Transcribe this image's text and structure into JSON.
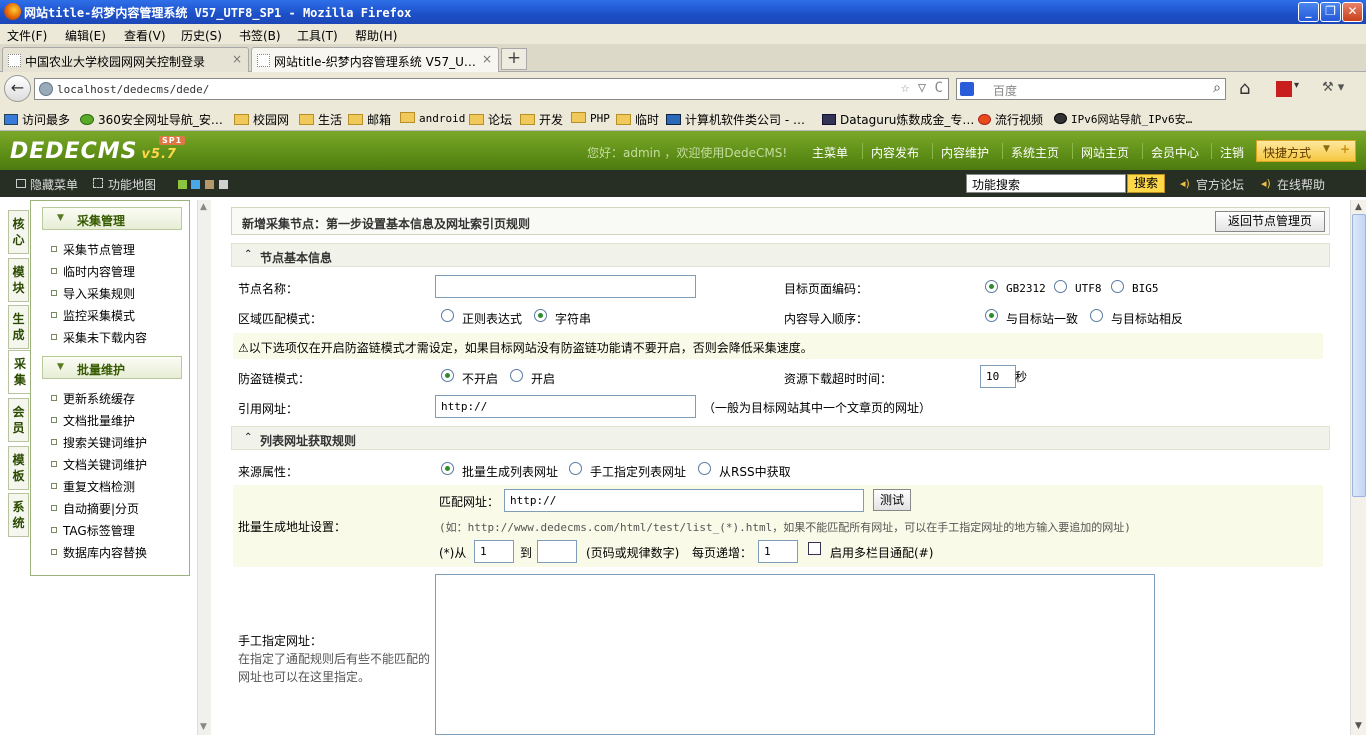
{
  "window": {
    "title": "网站title-织梦内容管理系统 V57_UTF8_SP1 - Mozilla Firefox",
    "min": "_",
    "max": "❐",
    "close": "✕"
  },
  "menubar": [
    "文件(F)",
    "编辑(E)",
    "查看(V)",
    "历史(S)",
    "书签(B)",
    "工具(T)",
    "帮助(H)"
  ],
  "tabs": [
    {
      "label": "中国农业大学校园网网关控制登录",
      "close": "×"
    },
    {
      "label": "网站title-织梦内容管理系统 V57_U…",
      "close": "×"
    }
  ],
  "newtab": "+",
  "nav": {
    "back": "←",
    "url": "localhost/dedecms/dede/",
    "url_icons": "☆ ▽ C",
    "search_placeholder": "百度",
    "search_icon": "⌕",
    "home": "⌂",
    "addon": "▾",
    "tools": "⚒ ▾"
  },
  "bookmarks": [
    "访问最多",
    "360安全网址导航_安…",
    "校园网",
    "生活",
    "邮箱",
    "android",
    "论坛",
    "开发",
    "PHP",
    "临时",
    "计算机软件类公司 - …",
    "Dataguru炼数成金_专…",
    "流行视频",
    "IPv6网站导航_IPv6安…"
  ],
  "header": {
    "logo": "DEDECMS",
    "version": "v5.7",
    "sp": "SP1",
    "welcome": "您好：admin ，欢迎使用DedeCMS!",
    "nav": [
      "主菜单",
      "内容发布",
      "内容维护",
      "系统主页",
      "网站主页",
      "会员中心",
      "注销"
    ],
    "quick": "快捷方式"
  },
  "toolbar": {
    "hide_menu": "隐藏菜单",
    "func_map": "功能地图",
    "search_value": "功能搜索",
    "search_btn": "搜索",
    "forum": "官方论坛",
    "help": "在线帮助"
  },
  "vtabs": [
    "核心",
    "模块",
    "生成",
    "采集",
    "会员",
    "模板",
    "系统"
  ],
  "leftmenu": {
    "group1": "采集管理",
    "group1_items": [
      "采集节点管理",
      "临时内容管理",
      "导入采集规则",
      "监控采集模式",
      "采集未下载内容"
    ],
    "group2": "批量维护",
    "group2_items": [
      "更新系统缓存",
      "文档批量维护",
      "搜索关键词维护",
      "文档关键词维护",
      "重复文档检测",
      "自动摘要|分页",
      "TAG标签管理",
      "数据库内容替换"
    ]
  },
  "main": {
    "title": "新增采集节点：第一步设置基本信息及网址索引页规则",
    "return_btn": "返回节点管理页",
    "sec1": "节点基本信息",
    "sec2": "列表网址获取规则",
    "node_name_lbl": "节点名称：",
    "encoding_lbl": "目标页面编码：",
    "enc_opts": [
      "GB2312",
      "UTF8",
      "BIG5"
    ],
    "match_mode_lbl": "区域匹配模式：",
    "match_opts": [
      "正则表达式",
      "字符串"
    ],
    "import_order_lbl": "内容导入顺序：",
    "order_opts": [
      "与目标站一致",
      "与目标站相反"
    ],
    "note": "以下选项仅在开启防盗链模式才需设定，如果目标网站没有防盗链功能请不要开启，否则会降低采集速度。",
    "antileech_lbl": "防盗链模式：",
    "antileech_opts": [
      "不开启",
      "开启"
    ],
    "timeout_lbl": "资源下载超时时间：",
    "timeout_val": "10",
    "timeout_unit": "秒",
    "refurl_lbl": "引用网址：",
    "refurl_val": "http://",
    "refurl_hint": "（一般为目标网站其中一个文章页的网址）",
    "source_lbl": "来源属性：",
    "source_opts": [
      "批量生成列表网址",
      "手工指定列表网址",
      "从RSS中获取"
    ],
    "batch_lbl": "批量生成地址设置：",
    "match_url_lbl": "匹配网址：",
    "match_url_val": "http://",
    "test_btn": "测试",
    "example": "(如：http://www.dedecms.com/html/test/list_(*).html，如果不能匹配所有网址，可以在手工指定网址的地方输入要追加的网址)",
    "from_lbl": "(*)从",
    "from_val": "1",
    "to_lbl": "到",
    "to_val": "",
    "page_hint": "(页码或规律数字)",
    "step_lbl": "每页递增：",
    "step_val": "1",
    "multi_lbl": "启用多栏目通配(#)",
    "manual_lbl": "手工指定网址：",
    "manual_hint1": "在指定了通配规则后有些不能匹配的",
    "manual_hint2": "网址也可以在这里指定。"
  }
}
